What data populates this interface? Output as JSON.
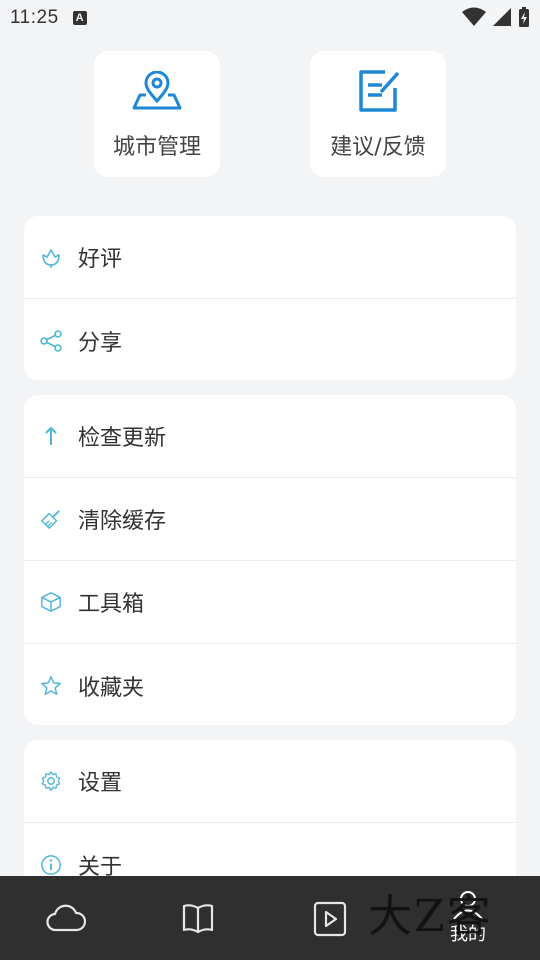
{
  "status_bar": {
    "time": "11:25",
    "notification_icon": "A"
  },
  "top_cards": {
    "city": {
      "label": "城市管理",
      "icon": "map-pin-icon"
    },
    "feedback": {
      "label": "建议/反馈",
      "icon": "edit-note-icon"
    }
  },
  "groups": {
    "g1": [
      {
        "label": "好评",
        "icon": "flower-icon"
      },
      {
        "label": "分享",
        "icon": "share-icon"
      }
    ],
    "g2": [
      {
        "label": "检查更新",
        "icon": "arrow-up-icon"
      },
      {
        "label": "清除缓存",
        "icon": "broom-icon"
      },
      {
        "label": "工具箱",
        "icon": "box-icon"
      },
      {
        "label": "收藏夹",
        "icon": "star-icon"
      }
    ],
    "g3": [
      {
        "label": "设置",
        "icon": "gear-icon"
      },
      {
        "label": "关于",
        "icon": "info-icon"
      }
    ]
  },
  "bottom_nav": {
    "mine_label": "我的"
  },
  "watermark": "大Z客",
  "colors": {
    "accent": "#4fb6d8",
    "background": "#f3f4f6",
    "nav_bg": "#2f2f2f"
  }
}
